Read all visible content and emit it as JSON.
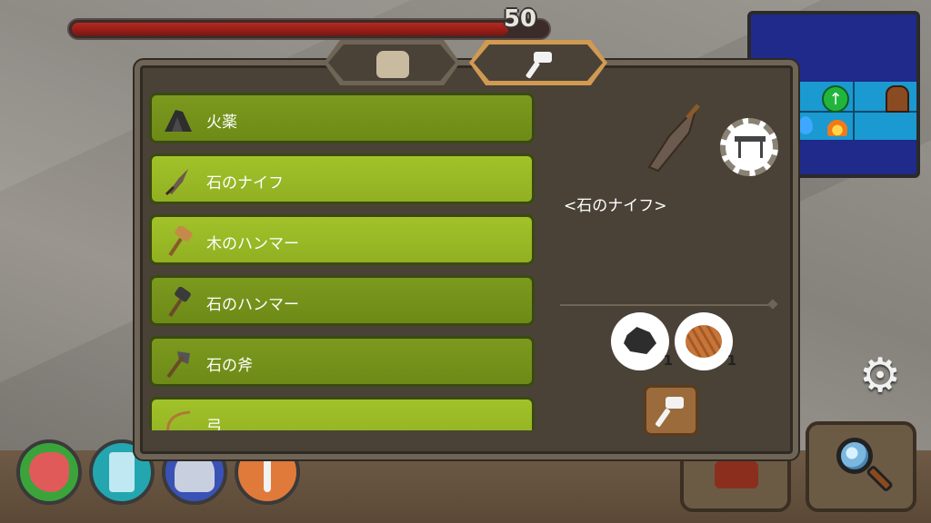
{
  "hud": {
    "health_value": "50",
    "health_fraction": 0.92
  },
  "tabs": [
    {
      "name": "backpack",
      "icon": "backpack-icon",
      "active": false
    },
    {
      "name": "crafting",
      "icon": "hammer-icon",
      "active": true
    }
  ],
  "recipes": [
    {
      "label": "火薬",
      "icon": "gunpowder-icon"
    },
    {
      "label": "石のナイフ",
      "icon": "stone-knife-icon"
    },
    {
      "label": "木のハンマー",
      "icon": "wooden-hammer-icon"
    },
    {
      "label": "石のハンマー",
      "icon": "stone-hammer-icon"
    },
    {
      "label": "石の斧",
      "icon": "stone-axe-icon"
    },
    {
      "label": "弓",
      "icon": "bow-icon"
    }
  ],
  "selected": {
    "name": "<石のナイフ>",
    "station_icon": "workbench-icon",
    "ingredients": [
      {
        "icon": "coal-icon",
        "count": "1"
      },
      {
        "icon": "yarn-icon",
        "count": "1"
      }
    ]
  },
  "colors": {
    "row_dark": "#7c9a1e",
    "row_light": "#a2c22a",
    "panel": "#4a4237",
    "health": "#b42a22"
  }
}
